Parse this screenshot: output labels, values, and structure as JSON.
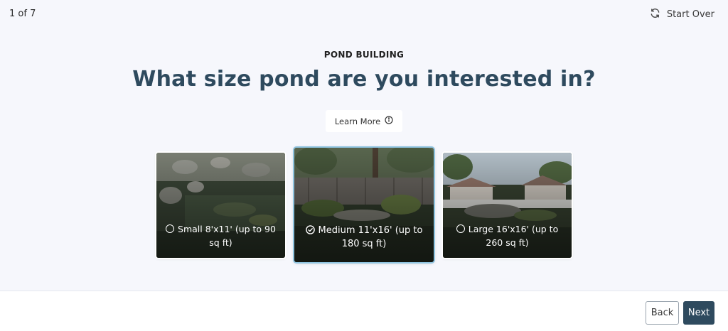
{
  "header": {
    "step_counter": "1 of 7",
    "start_over_label": "Start Over"
  },
  "question": {
    "eyebrow": "POND BUILDING",
    "title": "What size pond are you interested in?",
    "learn_more_label": "Learn More"
  },
  "options": [
    {
      "label": "Small 8'x11' (up to 90 sq ft)",
      "selected": false
    },
    {
      "label": "Medium 11'x16' (up to 180 sq ft)",
      "selected": true
    },
    {
      "label": "Large 16'x16' (up to 260 sq ft)",
      "selected": false
    }
  ],
  "footer": {
    "back_label": "Back",
    "next_label": "Next"
  },
  "colors": {
    "accent": "#2e4a5e",
    "background": "#f6f7fc",
    "selected_border": "#8fc4e0"
  }
}
